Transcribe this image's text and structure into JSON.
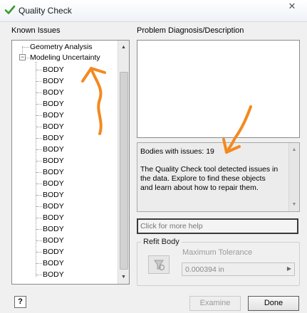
{
  "window": {
    "title": "Quality Check",
    "close_glyph": "✕",
    "title_icon": "checkmark-icon",
    "accent_color": "#3a9a2a"
  },
  "known_issues": {
    "label": "Known Issues",
    "items": [
      {
        "label": "Geometry Analysis"
      },
      {
        "label": "Modeling Uncertainty",
        "expanded": true,
        "children": [
          "BODY",
          "BODY",
          "BODY",
          "BODY",
          "BODY",
          "BODY",
          "BODY",
          "BODY",
          "BODY",
          "BODY",
          "BODY",
          "BODY",
          "BODY",
          "BODY",
          "BODY",
          "BODY",
          "BODY",
          "BODY",
          "BODY"
        ]
      }
    ],
    "expander_glyph": "−",
    "scroll_up_glyph": "▲",
    "scroll_down_glyph": "▼"
  },
  "diagnosis": {
    "label": "Problem Diagnosis/Description",
    "bodies_line": "Bodies with issues: 19",
    "message_lines": [
      "The Quality Check tool detected issues in",
      "the data.  Explore to find these objects",
      "and learn about how to repair them."
    ],
    "scroll_up_glyph": "▲",
    "scroll_down_glyph": "▼"
  },
  "help_input": {
    "placeholder": "Click for more help",
    "value": ""
  },
  "refit_body": {
    "label": "Refit Body",
    "max_tolerance_label": "Maximum Tolerance",
    "max_tolerance_value": "0.000394 in",
    "arrow_glyph": "▶",
    "icon": "refit-body-icon"
  },
  "footer": {
    "help_glyph": "?",
    "examine_label": "Examine",
    "done_label": "Done"
  },
  "annotation_color": "#f28a1e"
}
